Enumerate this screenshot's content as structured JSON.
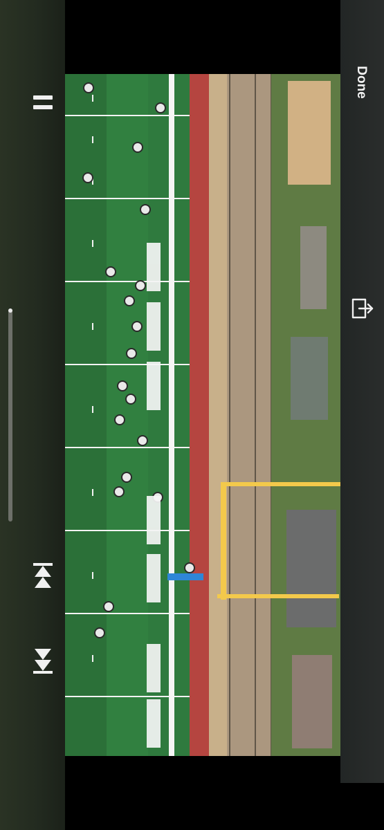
{
  "player": {
    "done_label": "Done",
    "playback_state": "playing",
    "progress_fraction": 0.02,
    "controls": {
      "pause_icon": "pause-icon",
      "share_icon": "share-icon",
      "skip_back_icon": "skip-back-icon",
      "skip_forward_icon": "skip-forward-icon"
    }
  },
  "video": {
    "content": "football-practice-field-footage",
    "orientation": "rotated"
  },
  "colors": {
    "accent": "#ffffff",
    "rail_dark": "#232b20",
    "scrubber_track": "#6d7069",
    "scrubber_fill": "#e9e9e9"
  }
}
